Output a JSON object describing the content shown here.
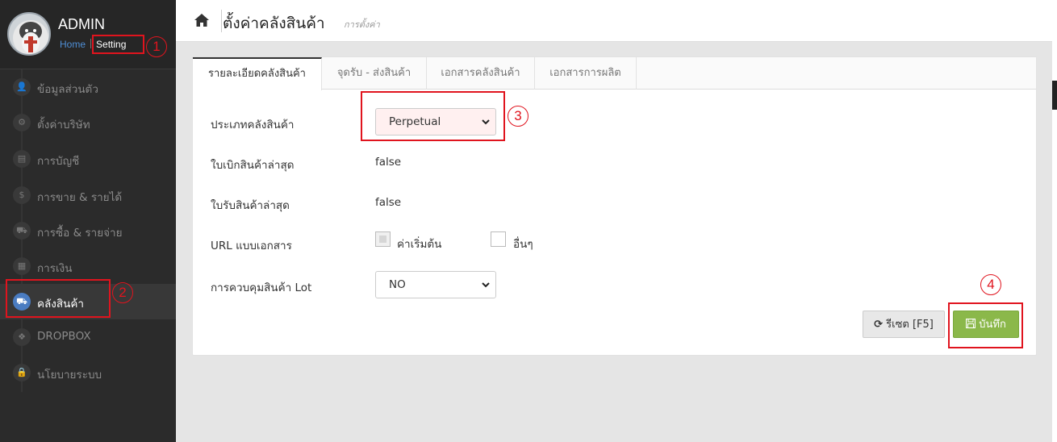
{
  "sidebar": {
    "admin_name": "ADMIN",
    "home_link": "Home",
    "setting_link": "Setting",
    "items": [
      {
        "label": "ข้อมูลส่วนตัว",
        "icon": "user-icon",
        "glyph": "👤"
      },
      {
        "label": "ตั้งค่าบริษัท",
        "icon": "gear-icon",
        "glyph": "⚙"
      },
      {
        "label": "การบัญชี",
        "icon": "book-icon",
        "glyph": "▤"
      },
      {
        "label": "การขาย & รายได้",
        "icon": "dollar-icon",
        "glyph": "$"
      },
      {
        "label": "การซื้อ & รายจ่าย",
        "icon": "cart-icon",
        "glyph": "⛟"
      },
      {
        "label": "การเงิน",
        "icon": "calendar-icon",
        "glyph": "▦"
      },
      {
        "label": "คลังสินค้า",
        "icon": "truck-icon",
        "glyph": "⛟"
      },
      {
        "label": "DROPBOX",
        "icon": "dropbox-icon",
        "glyph": "❖"
      },
      {
        "label": "นโยบายระบบ",
        "icon": "lock-icon",
        "glyph": "🔒"
      }
    ],
    "active_index": 6
  },
  "header": {
    "title": "ตั้งค่าคลังสินค้า",
    "subtitle": "การตั้งค่า"
  },
  "tabs": [
    {
      "label": "รายละเอียดคลังสินค้า",
      "active": true
    },
    {
      "label": "จุดรับ - ส่งสินค้า",
      "active": false
    },
    {
      "label": "เอกสารคลังสินค้า",
      "active": false
    },
    {
      "label": "เอกสารการผลิต",
      "active": false
    }
  ],
  "form": {
    "warehouse_type_label": "ประเภทคลังสินค้า",
    "warehouse_type_value": "Perpetual",
    "latest_issue_label": "ใบเบิกสินค้าล่าสุด",
    "latest_issue_value": "false",
    "latest_receipt_label": "ใบรับสินค้าล่าสุด",
    "latest_receipt_value": "false",
    "url_doc_label": "URL แบบเอกสาร",
    "url_default_label": "ค่าเริ่มต้น",
    "url_other_label": "อื่นๆ",
    "lot_control_label": "การควบคุมสินค้า Lot",
    "lot_control_value": "NO"
  },
  "buttons": {
    "reset_label": "รีเซต [F5]",
    "save_label": "บันทึก"
  },
  "annotations": [
    "1",
    "2",
    "3",
    "4"
  ],
  "colors": {
    "sidebar_bg": "#2b2b2b",
    "active_icon": "#4a7cc1",
    "save_button": "#8bb84a",
    "annotation_red": "#e0141e"
  }
}
